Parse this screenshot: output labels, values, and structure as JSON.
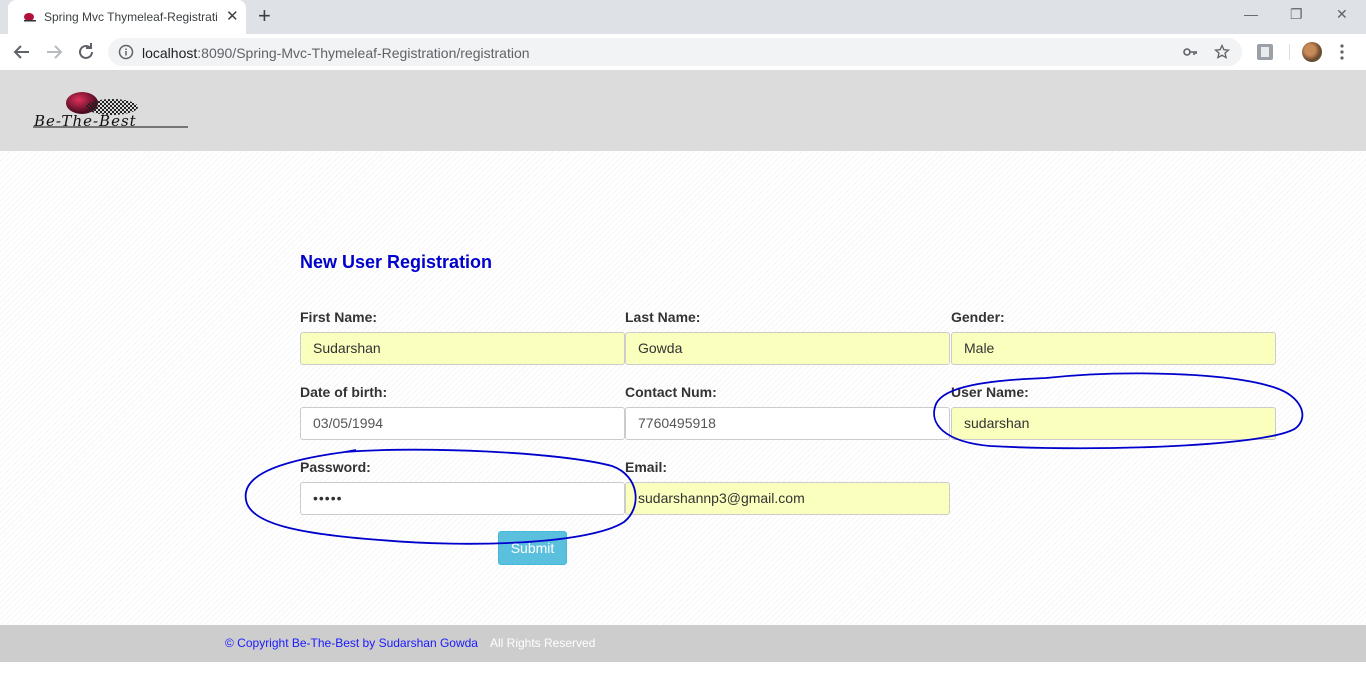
{
  "browser": {
    "tab_title": "Spring Mvc Thymeleaf-Registrati",
    "url_host": "localhost",
    "url_rest": ":8090/Spring-Mvc-Thymeleaf-Registration/registration"
  },
  "header": {
    "logo_text": "Be-The-Best"
  },
  "form": {
    "title": "New User Registration",
    "first_name": {
      "label": "First Name:",
      "value": "Sudarshan"
    },
    "last_name": {
      "label": "Last Name:",
      "value": "Gowda"
    },
    "gender": {
      "label": "Gender:",
      "value": "Male"
    },
    "dob": {
      "label": "Date of birth:",
      "value": "03/05/1994"
    },
    "contact": {
      "label": "Contact Num:",
      "value": "7760495918"
    },
    "username": {
      "label": "User Name:",
      "value": "sudarshan"
    },
    "password": {
      "label": "Password:",
      "value": "•••••"
    },
    "email": {
      "label": "Email:",
      "value": "sudarshannp3@gmail.com"
    },
    "submit_label": "Submit"
  },
  "footer": {
    "copyright": "© Copyright Be-The-Best by Sudarshan Gowda",
    "rights": "All Rights Reserved"
  },
  "colors": {
    "title": "#0000cc",
    "autofill": "#faffbd",
    "submit": "#5bc0de",
    "annotation": "#0000cc"
  }
}
